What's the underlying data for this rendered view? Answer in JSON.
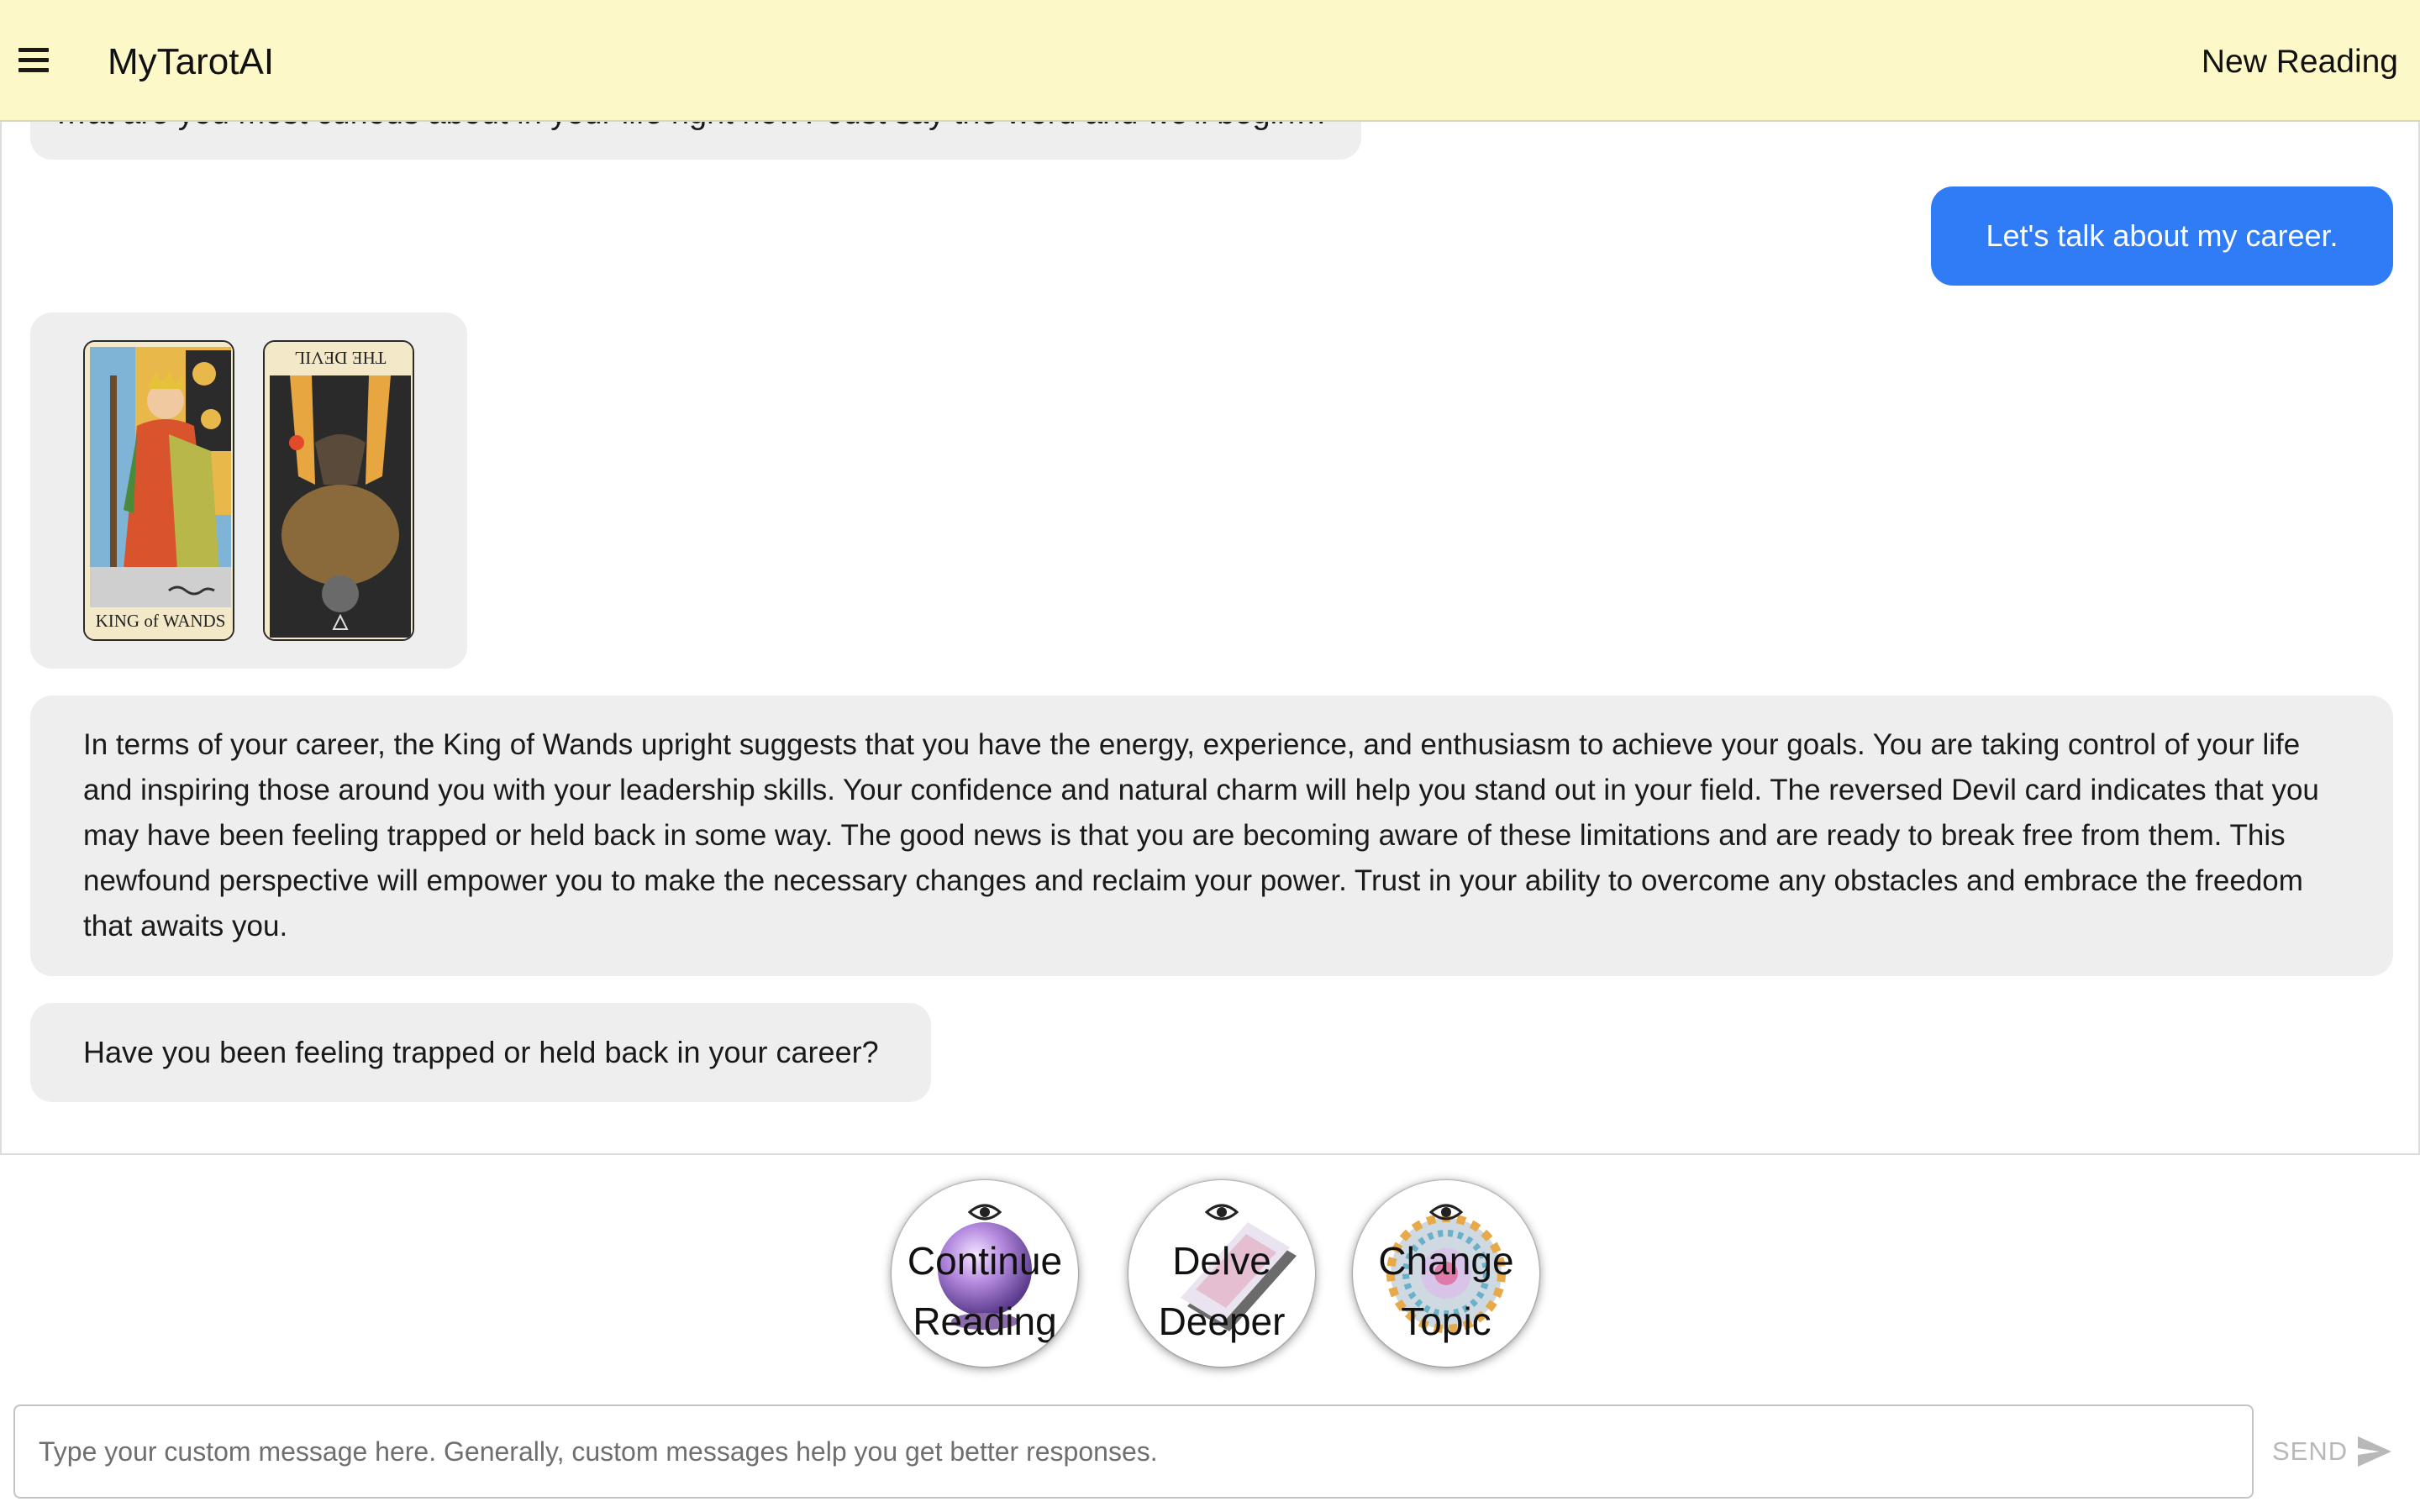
{
  "header": {
    "title": "MyTarotAI",
    "action_label": "New Reading",
    "background": "#fdf8c8"
  },
  "chat": {
    "partial_message": "…at are you most curious about in your life right now? Just say the word and we'll begin…",
    "user_message": "Let's talk about my career.",
    "cards": [
      {
        "name": "King of Wands",
        "caption": "KING of WANDS",
        "orientation": "upright"
      },
      {
        "name": "The Devil",
        "caption": "THE DEVIL",
        "orientation": "reversed"
      }
    ],
    "reading": "In terms of your career, the King of Wands upright suggests that you have the energy, experience, and enthusiasm to achieve your goals. You are taking control of your life and inspiring those around you with your leadership skills. Your confidence and natural charm will help you stand out in your field. The reversed Devil card indicates that you may have been feeling trapped or held back in some way. The good news is that you are becoming aware of these limitations and are ready to break free from them. This newfound perspective will empower you to make the necessary changes and reclaim your power. Trust in your ability to overcome any obstacles and embrace the freedom that awaits you.",
    "question": "Have you been feeling trapped or held back in your career?",
    "user_bubble_color": "#2f7cf6",
    "ai_bubble_color": "#eeeeee"
  },
  "actions": [
    {
      "line1": "Continue",
      "line2": "Reading",
      "icon": "eye-icon",
      "art": "crystal-ball"
    },
    {
      "line1": "Delve",
      "line2": "Deeper",
      "icon": "eye-icon",
      "art": "stacked-cards"
    },
    {
      "line1": "Change",
      "line2": "Topic",
      "icon": "eye-icon",
      "art": "zodiac-wheel"
    }
  ],
  "composer": {
    "placeholder": "Type your custom message here. Generally, custom messages help you get better responses.",
    "value": "",
    "send_label": "SEND",
    "send_icon": "send-icon"
  }
}
